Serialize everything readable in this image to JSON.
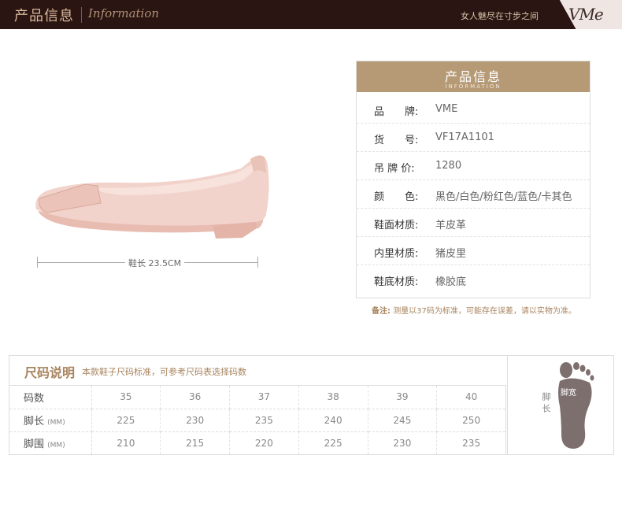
{
  "header": {
    "title_cn": "产品信息",
    "title_en": "Information",
    "slogan": "女人魅尽在寸步之间",
    "logo": "VMe"
  },
  "shoe": {
    "length_label": "鞋长 23.5CM"
  },
  "info": {
    "head_cn": "产品信息",
    "head_en": "INFORMATION",
    "rows": [
      {
        "label": "品　　牌:",
        "value": "VME"
      },
      {
        "label": "货　　号:",
        "value": "VF17A1101"
      },
      {
        "label": "吊 牌 价:",
        "value": "1280"
      },
      {
        "label": "颜　　色:",
        "value": "黑色/白色/粉红色/蓝色/卡其色"
      },
      {
        "label": "鞋面材质:",
        "value": "羊皮革"
      },
      {
        "label": "内里材质:",
        "value": "猪皮里"
      },
      {
        "label": "鞋底材质:",
        "value": "橡胶底"
      }
    ],
    "note_label": "备注:",
    "note_text": "测量以37码为标准，可能存在误差，请以实物为准。"
  },
  "size_chart": {
    "title": "尺码说明",
    "desc": "本款鞋子尺码标准，可参考尺码表选择码数",
    "rows": [
      {
        "label": "码数",
        "unit": "",
        "values": [
          "35",
          "36",
          "37",
          "38",
          "39",
          "40"
        ]
      },
      {
        "label": "脚长",
        "unit": "(MM)",
        "values": [
          "225",
          "230",
          "235",
          "240",
          "245",
          "250"
        ]
      },
      {
        "label": "脚围",
        "unit": "(MM)",
        "values": [
          "210",
          "215",
          "220",
          "225",
          "230",
          "235"
        ]
      }
    ],
    "foot_length_label": "脚长",
    "foot_width_label": "脚宽"
  },
  "colors": {
    "header_bg": "#2a1512",
    "accent": "#b69a76",
    "shoe_pink": "#f0cfc6"
  }
}
